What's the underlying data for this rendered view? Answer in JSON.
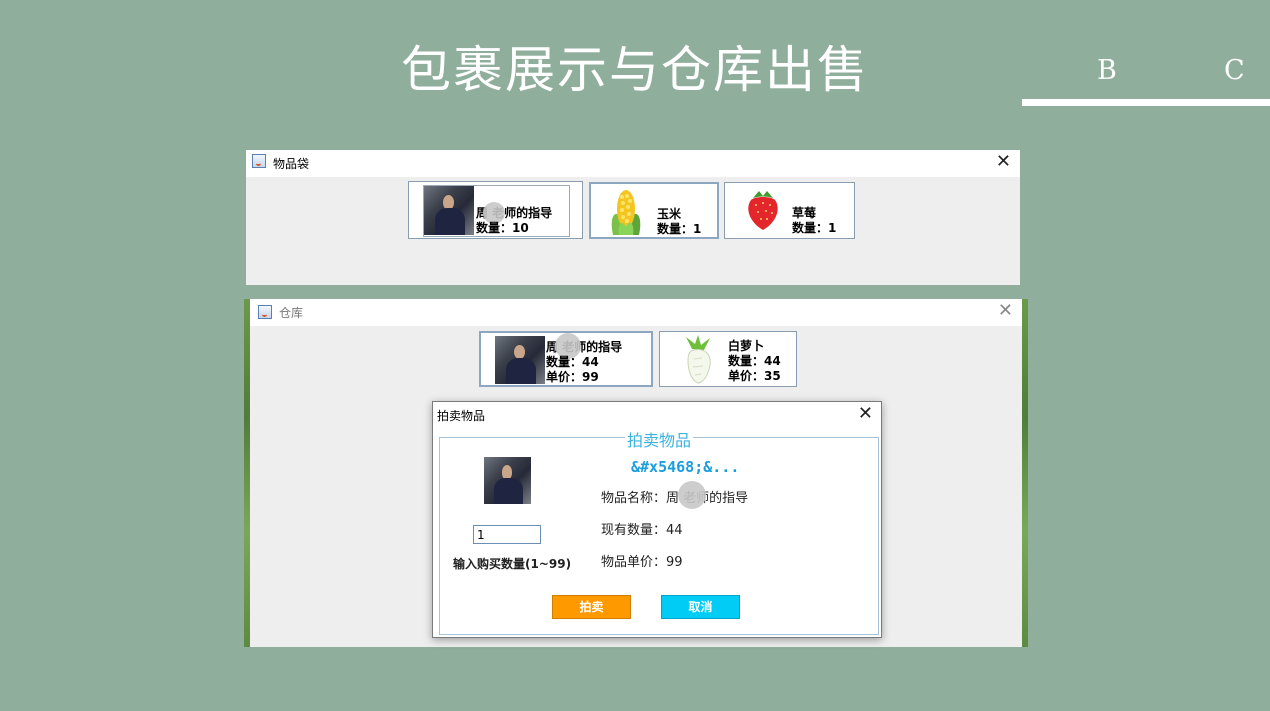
{
  "slide": {
    "title": "包裹展示与仓库出售",
    "nav": [
      "B",
      "C"
    ]
  },
  "bag_window": {
    "title": "物品袋",
    "items": [
      {
        "name": "周 老师的指导",
        "qty_label": "数量：10",
        "icon": "teacher-photo"
      },
      {
        "name": "玉米",
        "qty_label": "数量：1",
        "icon": "corn-icon"
      },
      {
        "name": "草莓",
        "qty_label": "数量：1",
        "icon": "strawberry-icon"
      }
    ]
  },
  "warehouse_window": {
    "title": "仓库",
    "items": [
      {
        "name": "周 老师的指导",
        "qty_label": "数量：44",
        "price_label": "单价：99",
        "icon": "teacher-photo"
      },
      {
        "name": "白萝卜",
        "qty_label": "数量：44",
        "price_label": "单价：35",
        "icon": "radish-icon"
      }
    ]
  },
  "auction_dialog": {
    "title": "拍卖物品",
    "group_title": "拍卖物品",
    "heading": "&#x5468;&...",
    "item_name": "物品名称：周 老师的指导",
    "stock": "现有数量：44",
    "unit_price": "物品单价：99",
    "qty_value": "1",
    "qty_hint": "输入购买数量(1~99)",
    "auction_button": "拍卖",
    "cancel_button": "取消",
    "colors": {
      "auction": "#ff9900",
      "cancel": "#00ccf5",
      "heading": "#1a9ee0"
    }
  }
}
